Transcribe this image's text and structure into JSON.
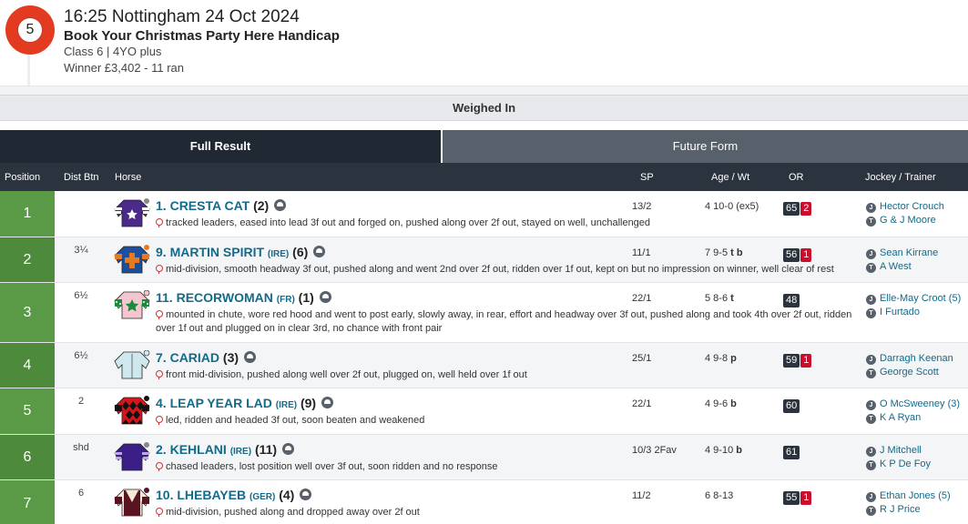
{
  "race": {
    "number": "5",
    "title": "16:25 Nottingham 24 Oct 2024",
    "name": "Book Your Christmas Party Here Handicap",
    "class_info": "Class 6 | 4YO plus",
    "winner_info": "Winner £3,402 - 11 ran"
  },
  "status_bar": {
    "label": "Weighed In"
  },
  "tabs": {
    "full_result": "Full Result",
    "future_form": "Future Form"
  },
  "columns": {
    "position": "Position",
    "dist_btn": "Dist Btn",
    "horse": "Horse",
    "sp": "SP",
    "age_wt": "Age / Wt",
    "or": "OR",
    "jockey_trainer": "Jockey / Trainer"
  },
  "rows": [
    {
      "position": "1",
      "dist": "",
      "number": "1.",
      "horse": "CRESTA CAT",
      "country": "",
      "draw": "(2)",
      "comment": "tracked leaders, eased into lead 3f out and forged on, pushed along over 2f out, stayed on well, unchallenged",
      "sp": "13/2",
      "agewt": "4 10-0 (ex5)",
      "agewt_extra": "",
      "or": "65",
      "days": "2",
      "jockey": "Hector Crouch",
      "trainer": "G & J Moore"
    },
    {
      "position": "2",
      "dist": "3¼",
      "number": "9.",
      "horse": "MARTIN SPIRIT",
      "country": "(IRE)",
      "draw": "(6)",
      "comment": "mid-division, smooth headway 3f out, pushed along and went 2nd over 2f out, ridden over 1f out, kept on but no impression on winner, well clear of rest",
      "sp": "11/1",
      "agewt": "7 9-5",
      "agewt_extra": "t b",
      "or": "56",
      "days": "1",
      "jockey": "Sean Kirrane",
      "trainer": "A West"
    },
    {
      "position": "3",
      "dist": "6½",
      "number": "11.",
      "horse": "RECORWOMAN",
      "country": "(FR)",
      "draw": "(1)",
      "comment": "mounted in chute, wore red hood and went to post early, slowly away, in rear, effort and headway over 3f out, pushed along and took 4th over 2f out, ridden over 1f out and plugged on in clear 3rd, no chance with front pair",
      "sp": "22/1",
      "agewt": "5 8-6",
      "agewt_extra": "t",
      "or": "48",
      "days": "",
      "jockey": "Elle-May Croot (5)",
      "trainer": "I Furtado"
    },
    {
      "position": "4",
      "dist": "6½",
      "number": "7.",
      "horse": "CARIAD",
      "country": "",
      "draw": "(3)",
      "comment": "front mid-division, pushed along well over 2f out, plugged on, well held over 1f out",
      "sp": "25/1",
      "agewt": "4 9-8",
      "agewt_extra": "p",
      "or": "59",
      "days": "1",
      "jockey": "Darragh Keenan",
      "trainer": "George Scott"
    },
    {
      "position": "5",
      "dist": "2",
      "number": "4.",
      "horse": "LEAP YEAR LAD",
      "country": "(IRE)",
      "draw": "(9)",
      "comment": "led, ridden and headed 3f out, soon beaten and weakened",
      "sp": "22/1",
      "agewt": "4 9-6",
      "agewt_extra": "b",
      "or": "60",
      "days": "",
      "jockey": "O McSweeney (3)",
      "trainer": "K A Ryan"
    },
    {
      "position": "6",
      "dist": "shd",
      "number": "2.",
      "horse": "KEHLANI",
      "country": "(IRE)",
      "draw": "(11)",
      "comment": "chased leaders, lost position well over 3f out, soon ridden and no response",
      "sp": "10/3 2Fav",
      "agewt": "4 9-10",
      "agewt_extra": "b",
      "or": "61",
      "days": "",
      "jockey": "J Mitchell",
      "trainer": "K P De Foy"
    },
    {
      "position": "7",
      "dist": "6",
      "number": "10.",
      "horse": "LHEBAYEB",
      "country": "(GER)",
      "draw": "(4)",
      "comment": "mid-division, pushed along and dropped away over 2f out",
      "sp": "11/2",
      "agewt": "6 8-13",
      "agewt_extra": "",
      "or": "55",
      "days": "1",
      "jockey": "Ethan Jones (5)",
      "trainer": "R J Price"
    }
  ],
  "icons": {
    "jockey": "J",
    "trainer": "T"
  },
  "colors": {
    "position_green": "#5a9a46",
    "header_dark": "#2b333e",
    "horse_link": "#136a89",
    "days_red": "#c8102e"
  }
}
